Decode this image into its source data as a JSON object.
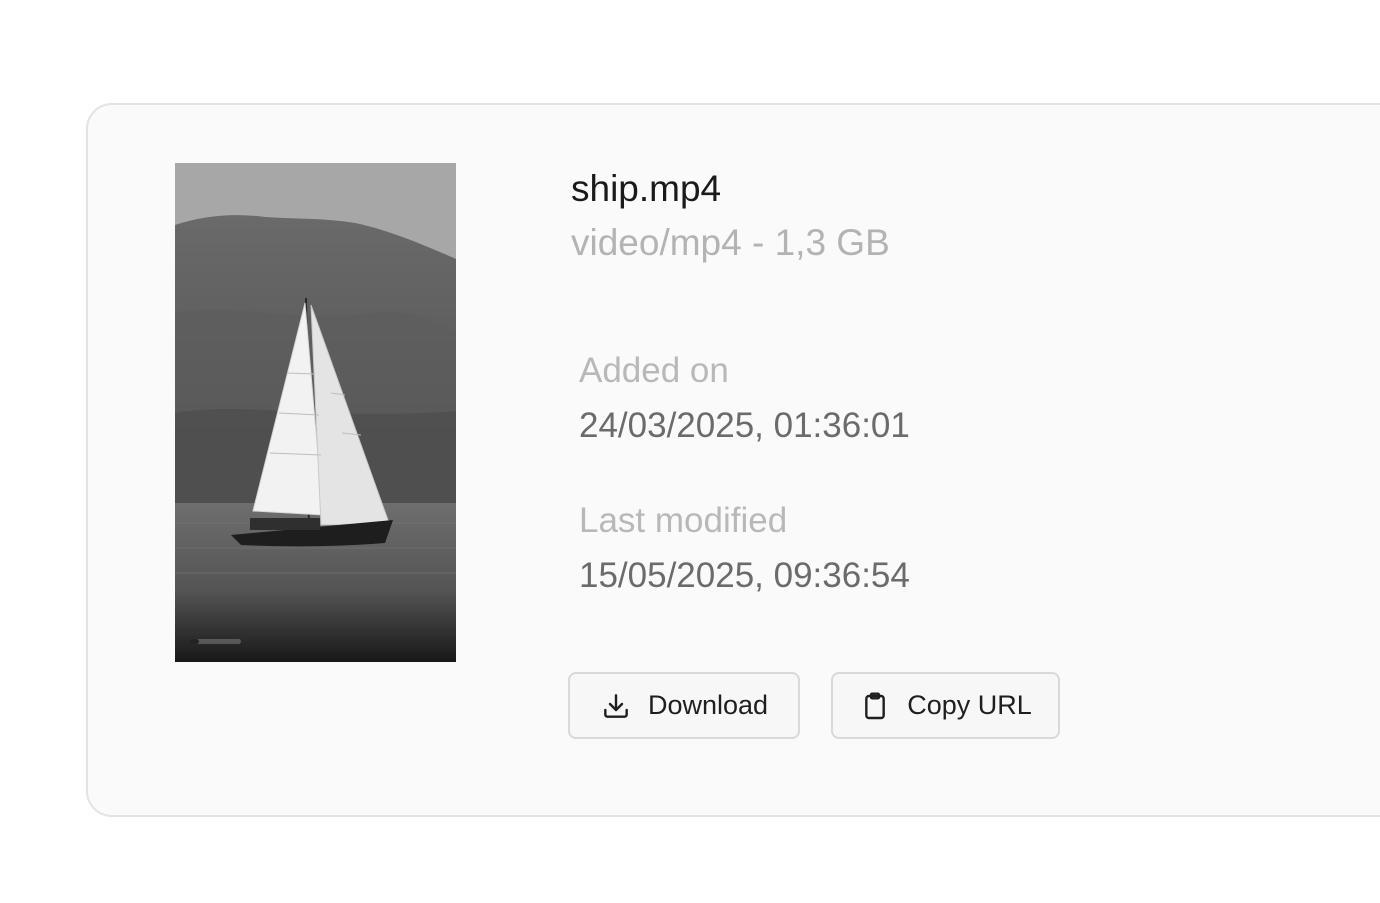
{
  "file": {
    "name": "ship.mp4",
    "meta": "video/mp4 - 1,3 GB"
  },
  "video": {
    "playback_progress": 0.2
  },
  "details": {
    "added_label": "Added on",
    "added_value": "24/03/2025, 01:36:01",
    "modified_label": "Last modified",
    "modified_value": "15/05/2025, 09:36:54"
  },
  "actions": {
    "download_label": "Download",
    "copy_url_label": "Copy URL"
  },
  "icons": {
    "download": "download-icon",
    "copy": "clipboard-icon"
  }
}
